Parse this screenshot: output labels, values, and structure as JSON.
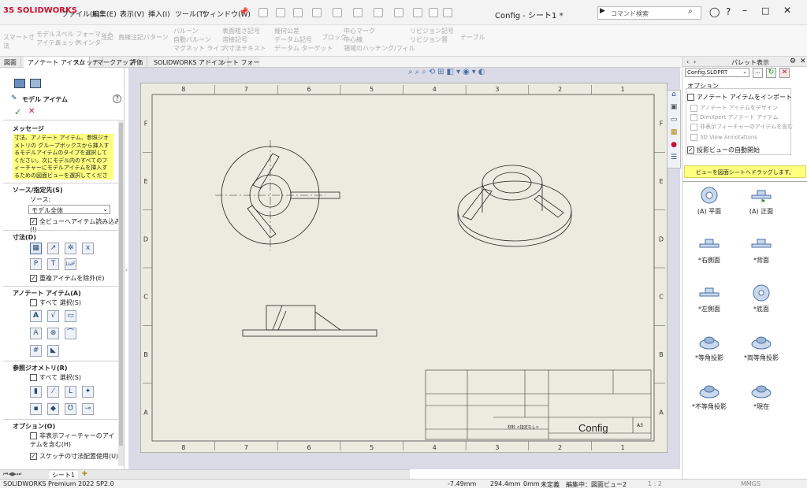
{
  "app": {
    "logo_ds": "3S",
    "logo_text": "SOLIDWORKS",
    "window_title": "Config - シート1 *"
  },
  "menu": [
    "ファイル(F)",
    "編集(E)",
    "表示(V)",
    "挿入(I)",
    "ツール(T)",
    "ウィンドウ(W)"
  ],
  "search": {
    "placeholder": "コマンド検索"
  },
  "ribbon": {
    "smart_dim": "スマート寸法",
    "model_items": "モデル\nアイテム",
    "spell_check": "スペル\nチェック",
    "format_painter": "フォーマット\nペインタ",
    "note": "注記",
    "linear_note_pattern": "直線注記パターン",
    "balloon": "バルーン",
    "auto_balloon": "自動バルーン",
    "magnetic_line": "マグネット ライン",
    "surface_finish": "表面粗さ記号",
    "weld_symbol": "溶接記号",
    "hole_callout": "穴寸法テキスト",
    "geo_tol": "幾何公差",
    "datum_feature": "データム記号",
    "datum_target": "データム ターゲット",
    "block": "ブロック",
    "center_mark": "中心マーク",
    "centerline": "中心線",
    "area_hatch": "領域のハッチング/フィル",
    "rev_symbol": "リビジョン記号",
    "rev_cloud": "リビジョン雲",
    "table": "テーブル"
  },
  "tabs": [
    "図面",
    "アノテート アイテム",
    "スケッチ",
    "マークアップ",
    "評価",
    "SOLIDWORKS アドイン",
    "シート フォーマット"
  ],
  "left": {
    "title": "モデル アイテム",
    "help": "?",
    "ok": "✓",
    "cancel": "✕",
    "msg_header": "メッセージ",
    "message": "寸法、アノテート アイテム、参照ジオメトリの グループボックスから挿入するモデルアイテムのタイプを選択してください。次にモデル内のすべてのフィーチャーにモデルアイテムを挿入するための図面ビューを選択してください",
    "source_header": "ソース/指定先(S)",
    "source_label": "ソース:",
    "source_value": "モデル全体",
    "import_all": "全ビューへアイテム読み込み(I)",
    "dims_header": "寸法(D)",
    "dims_exclude": "重複アイテムを除外(E)",
    "annot_header": "アノテート アイテム(A)",
    "annot_all": "すべて 選択(S)",
    "refgeo_header": "参照ジオメトリ(R)",
    "refgeo_all": "すべて 選択(S)",
    "opt_header": "オプション(O)",
    "opt_hidden": "非表示フィーチャーのアイテムを含む(H)",
    "opt_sketch": "スケッチの寸法配置使用(U)"
  },
  "sheet": {
    "cols": [
      "8",
      "7",
      "6",
      "5",
      "4",
      "3",
      "2",
      "1"
    ],
    "rows": [
      "F",
      "E",
      "D",
      "C",
      "B",
      "A"
    ],
    "title_name": "Config",
    "size": "A3",
    "material": "材料 <指定なし>"
  },
  "right": {
    "header": "パレット表示",
    "file": "Config.SLDPRT",
    "opt_header": "オプション",
    "import_annot": "アノテート アイテムをインポート",
    "design_annot": "アノテート アイテムをデザイン",
    "dimxpert": "DimXpert アノテート アイテム",
    "hidden_feat": "非表示フィーチャーのアイテムを含む",
    "view_annot": "3D View Annotations",
    "auto_proj": "投影ビューの自動開始",
    "drag_hint": "ビューを図面シートへドラッグします。",
    "views": [
      "(A) 平面",
      "(A) 正面",
      "*右側面",
      "*背面",
      "*左側面",
      "*底面",
      "*等角投影",
      "*両等角投影",
      "*不等角投影",
      "*現在"
    ]
  },
  "status": {
    "app": "SOLIDWORKS Premium 2022 SP2.0",
    "x": "-7.49mm",
    "y": "294.4mm",
    "z": "0mm",
    "def": "未定義",
    "edit": "編集中：図面ビュー2",
    "scale": "1 : 2",
    "units": "MMGS",
    "sheet_tab": "シート1"
  },
  "colors": {
    "accent_red": "#c8102e",
    "sheet_bg": "#ecebdf",
    "msg_bg": "#ffff80",
    "canvas_bg": "#dadbe6"
  }
}
